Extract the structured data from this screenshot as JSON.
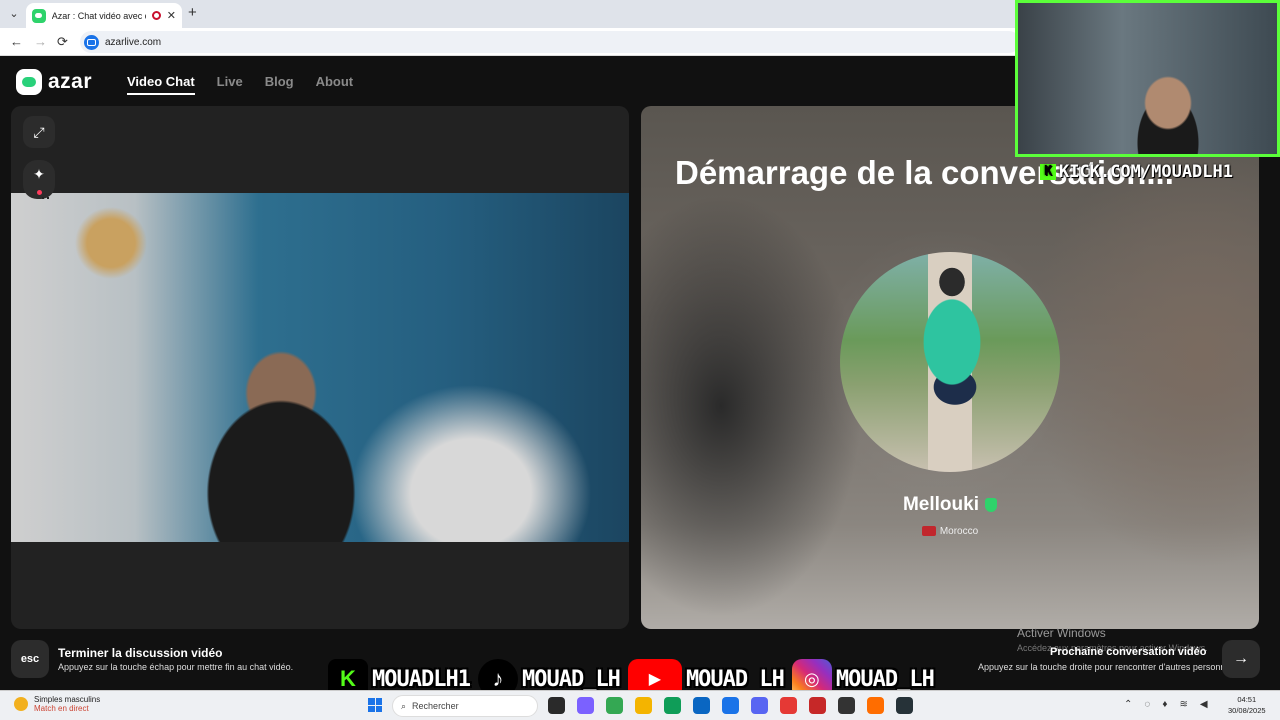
{
  "browser": {
    "tab_title": "Azar : Chat vidéo avec de n",
    "new_tab": "+",
    "close": "✕",
    "back": "←",
    "forward": "→",
    "reload": "⟳",
    "url": "azarlive.com"
  },
  "site": {
    "logo_text": "azar",
    "nav": [
      "Video Chat",
      "Live",
      "Blog",
      "About"
    ],
    "active_nav": "Video Chat"
  },
  "left_panel": {
    "tools": [
      "expand-icon",
      "sparkle-icon",
      "face-filter-icon"
    ]
  },
  "right_panel": {
    "title": "Démarrage de la conversation...",
    "profile_name": "Mellouki",
    "country": "Morocco"
  },
  "overlay": {
    "kick_name": "KICK.COM/MOUADLH1",
    "socials": [
      {
        "icon": "kick-icon",
        "glyph": "K",
        "label": "MOUADLH1"
      },
      {
        "icon": "tiktok-icon",
        "glyph": "♪",
        "label": "MOUAD_LH"
      },
      {
        "icon": "youtube-icon",
        "glyph": "▶",
        "label": "MOUAD LH"
      },
      {
        "icon": "instagram-icon",
        "glyph": "◎",
        "label": "MOUAD_LH"
      }
    ]
  },
  "bottom": {
    "esc_key": "esc",
    "end_title": "Terminer la discussion vidéo",
    "end_sub": "Appuyez sur la touche échap pour mettre fin au chat vidéo.",
    "next_title": "Prochaine conversation vidéo",
    "next_sub": "Appuyez sur la touche droite pour rencontrer d'autres personnes",
    "next_arrow": "→",
    "activate_title": "Activer Windows",
    "activate_sub": "Accédez aux paramètres pour activer Windows."
  },
  "taskbar": {
    "weather_title": "Simples masculins",
    "weather_sub": "Match en direct",
    "search_placeholder": "Rechercher",
    "time": "04:51",
    "date": "30/08/2025",
    "app_colors": [
      "#2a2a2a",
      "#7b61ff",
      "#34a853",
      "#f4b400",
      "#0f9d58",
      "#0a66c2",
      "#1a73e8",
      "#5865f2",
      "#e53935",
      "#c62828",
      "#333333",
      "#ff6d00",
      "#263238"
    ]
  }
}
